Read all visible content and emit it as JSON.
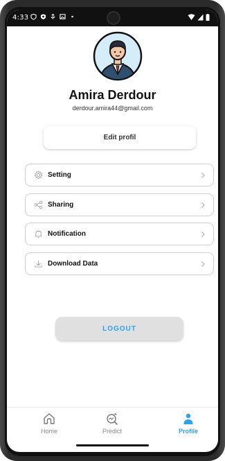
{
  "status_bar": {
    "time": "4:33"
  },
  "profile": {
    "name": "Amira Derdour",
    "email": "derdour.amira44@gmail.com",
    "edit_label": "Edit profil"
  },
  "menu": [
    {
      "label": "Setting",
      "icon": "gear-icon"
    },
    {
      "label": "Sharing",
      "icon": "share-icon"
    },
    {
      "label": "Notification",
      "icon": "bell-icon"
    },
    {
      "label": "Download Data",
      "icon": "download-icon"
    }
  ],
  "logout_label": "LOGOUT",
  "bottom_nav": [
    {
      "label": "Home",
      "icon": "home-icon",
      "active": false
    },
    {
      "label": "Predict",
      "icon": "predict-icon",
      "active": false
    },
    {
      "label": "Profile",
      "icon": "person-icon",
      "active": true
    }
  ],
  "colors": {
    "accent": "#29a3f2",
    "avatar_bg": "#d5ecf9"
  }
}
